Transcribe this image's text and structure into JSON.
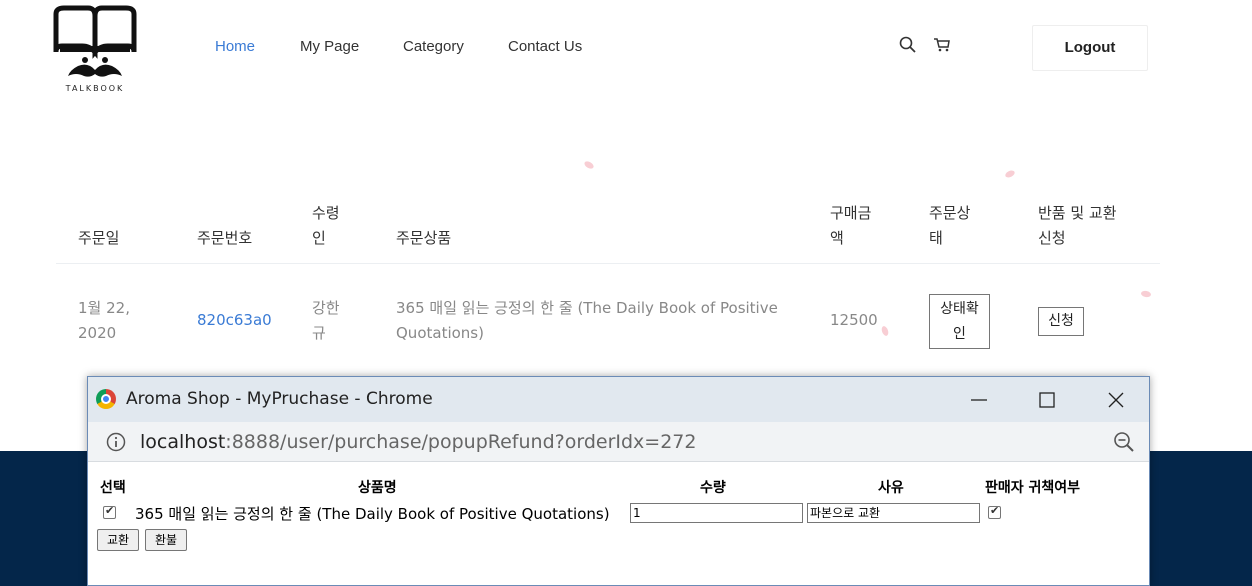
{
  "header": {
    "logo_text": "TALKBOOK",
    "nav": [
      "Home",
      "My Page",
      "Category",
      "Contact Us"
    ],
    "logout_label": "Logout"
  },
  "orders": {
    "headers": {
      "date": "주문일",
      "order_no": "주문번호",
      "recipient_1": "수령",
      "recipient_2": "인",
      "product": "주문상품",
      "amount_1": "구매금",
      "amount_2": "액",
      "status_1": "주문상",
      "status_2": "태",
      "refund_1": "반품 및 교환",
      "refund_2": "신청"
    },
    "row": {
      "date_1": "1월 22,",
      "date_2": "2020",
      "order_no": "820c63a0",
      "recipient_1": "강한",
      "recipient_2": "규",
      "product_1": "365 매일 읽는 긍정의 한 줄 (The Daily Book of Positive",
      "product_2": "Quotations)",
      "amount": "12500",
      "status_btn_1": "상태확",
      "status_btn_2": "인",
      "refund_btn": "신청"
    }
  },
  "popup": {
    "title": "Aroma Shop - MyPruchase - Chrome",
    "url_host": "localhost",
    "url_rest": ":8888/user/purchase/popupRefund?orderIdx=272",
    "columns": {
      "select": "선택",
      "product": "상품명",
      "qty": "수량",
      "reason": "사유",
      "seller_fault": "판매자 귀책여부"
    },
    "item": {
      "product": "365 매일 읽는 긍정의 한 줄 (The Daily Book of Positive Quotations)",
      "qty": "1",
      "reason": "파본으로 교환"
    },
    "buttons": {
      "exchange": "교환",
      "refund": "환불"
    }
  }
}
